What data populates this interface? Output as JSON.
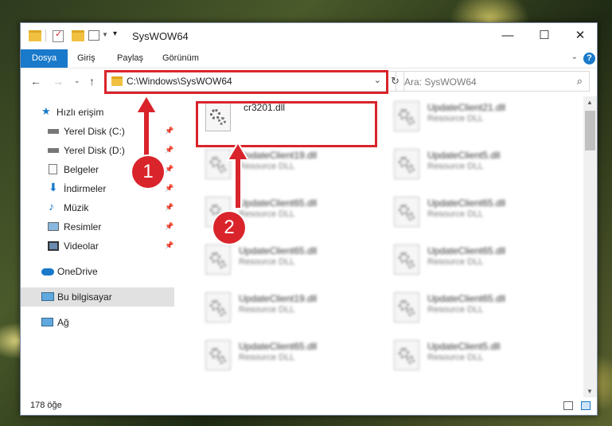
{
  "window": {
    "title": "SysWOW64",
    "minimize_glyph": "—",
    "maximize_glyph": "☐",
    "close_glyph": "✕"
  },
  "ribbon": {
    "tabs": [
      {
        "label": "Dosya",
        "active": true
      },
      {
        "label": "Giriş",
        "active": false
      },
      {
        "label": "Paylaş",
        "active": false
      },
      {
        "label": "Görünüm",
        "active": false
      }
    ],
    "help_glyph": "?"
  },
  "navigation": {
    "address": "C:\\Windows\\SysWOW64",
    "search_placeholder": "Ara: SysWOW64"
  },
  "sidebar": {
    "items": [
      {
        "label": "Hızlı erişim",
        "icon": "star-icon",
        "pinned": false
      },
      {
        "label": "Yerel Disk (C:)",
        "icon": "drive-icon",
        "pinned": true
      },
      {
        "label": "Yerel Disk (D:)",
        "icon": "drive-icon",
        "pinned": true
      },
      {
        "label": "Belgeler",
        "icon": "documents-icon",
        "pinned": true
      },
      {
        "label": "İndirmeler",
        "icon": "download-icon",
        "pinned": true
      },
      {
        "label": "Müzik",
        "icon": "music-icon",
        "pinned": true
      },
      {
        "label": "Resimler",
        "icon": "pictures-icon",
        "pinned": true
      },
      {
        "label": "Videolar",
        "icon": "videos-icon",
        "pinned": true
      },
      {
        "label": "OneDrive",
        "icon": "cloud-icon",
        "pinned": false
      },
      {
        "label": "Bu bilgisayar",
        "icon": "computer-icon",
        "pinned": false,
        "selected": true
      },
      {
        "label": "Ağ",
        "icon": "network-icon",
        "pinned": false
      }
    ]
  },
  "files": [
    {
      "name": "cr3201.dll",
      "type": ""
    },
    {
      "name": "UpdateClient21.dll",
      "type": "Resource DLL"
    },
    {
      "name": "UpdateClient19.dll",
      "type": "Resource DLL"
    },
    {
      "name": "UpdateClient5.dll",
      "type": "Resource DLL"
    },
    {
      "name": "UpdateClient65.dll",
      "type": "Resource DLL"
    },
    {
      "name": "UpdateClient65.dll",
      "type": "Resource DLL"
    },
    {
      "name": "UpdateClient65.dll",
      "type": "Resource DLL"
    },
    {
      "name": "UpdateClient65.dll",
      "type": "Resource DLL"
    },
    {
      "name": "UpdateClient19.dll",
      "type": "Resource DLL"
    },
    {
      "name": "UpdateClient65.dll",
      "type": "Resource DLL"
    },
    {
      "name": "UpdateClient65.dll",
      "type": "Resource DLL"
    },
    {
      "name": "UpdateClient5.dll",
      "type": "Resource DLL"
    }
  ],
  "status": {
    "item_count": "178 öğe"
  },
  "callouts": [
    {
      "label": "1"
    },
    {
      "label": "2"
    }
  ],
  "colors": {
    "accent": "#1979ca",
    "highlight_red": "#d9242b",
    "folder": "#f0c040"
  }
}
